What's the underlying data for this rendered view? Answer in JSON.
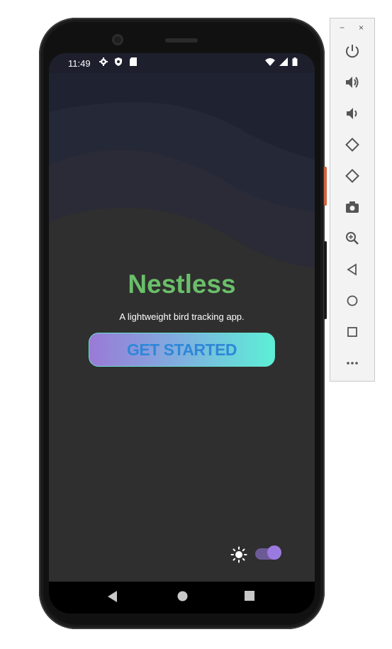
{
  "status_bar": {
    "time": "11:49",
    "left_icons": [
      "gear-icon",
      "shield-icon",
      "sd-card-icon"
    ],
    "right_icons": [
      "wifi-icon",
      "signal-icon",
      "battery-icon"
    ]
  },
  "app": {
    "title": "Nestless",
    "subtitle": "A lightweight bird tracking app.",
    "cta_label": "GET STARTED",
    "theme_toggle": {
      "mode": "dark",
      "on": true
    },
    "colors": {
      "title": "#6abf69",
      "cta_text": "#2f87d8",
      "cta_gradient_start": "#9a7ad6",
      "cta_gradient_end": "#5cf0d6",
      "background": "#2f2f2f",
      "wave_top": "#1f2230"
    }
  },
  "android_nav": {
    "buttons": [
      "back-icon",
      "home-icon",
      "recents-icon"
    ]
  },
  "emulator_panel": {
    "window_controls": [
      "−",
      "×"
    ],
    "tools": [
      "power-icon",
      "volume-up-icon",
      "volume-down-icon",
      "rotate-left-icon",
      "rotate-right-icon",
      "camera-icon",
      "zoom-icon",
      "back-icon",
      "home-icon",
      "overview-icon",
      "more-icon"
    ]
  }
}
